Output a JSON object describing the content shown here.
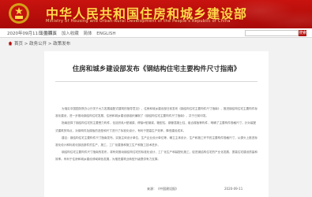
{
  "header": {
    "title": "中华人民共和国住房和城乡建设部",
    "subtitle": "Ministry of Housing and Urban-Rural Development of the People's Republic of China"
  },
  "infobar": {
    "date": "2020年09月11日 星期五",
    "tools": [
      "设为首页",
      "加入收藏",
      "简体",
      "ENGLISH"
    ],
    "search_placeholder": "",
    "search_button": "搜索"
  },
  "breadcrumb": {
    "text": "首页 > 政务公开 > 政策发布"
  },
  "article": {
    "title": "住房和城乡建设部发布《钢结构住宅主要构件尺寸指南》",
    "paragraphs": [
      "为落实中国国务院办公厅关于大力发展装配式建筑的指导意见》，住房和城乡建设部日前发布《钢结构住宅主要构件尺寸指南》，推进钢结构住宅主要构件标准化建设，进一步推动钢结构住宅发展，住房和城乡建设部组织编制了《钢结构住宅主要构件尺寸指南》，并于日前印发。",
      "指南选择了钢结构住宅的主要受力构件，包括热轧H型钢梁、焊接H型钢梁、箱型柱、钢管混凝土柱、组合楼板等构件，明确了主要构件规格尺寸，针对装配式建筑的特点，对钢构件及楼板的选型和尺寸进行了标准化设计，有利于提高生产效率，降低建设成本。",
      "建议：钢结构住宅主要构件尺寸指南发布，实施主体设计单位，生产企业设计单位等，确立主体设计、生产和施工环节的主要构件规格尺寸，从源头上推进标准化设计和标准化部品部件的生产，施工、工厂化建造和施工生产和施工技术进步。",
      "钢结构住宅主要构件尺寸指南的发布，将有效推动钢结构住宅的标准化设计、工厂化生产和装配化施工，促进钢结构住宅的产业化发展，提高住宅建设质量和效率。有利于住房和城乡建设领域绿色发展，为推进建筑业转型升级提供有力支撑。"
    ],
    "source": "来源：《中国建设报》",
    "date": "2020-09-11"
  },
  "colors": {
    "brand_red": "#b50d0a",
    "title_gold": "#ffd84a"
  }
}
